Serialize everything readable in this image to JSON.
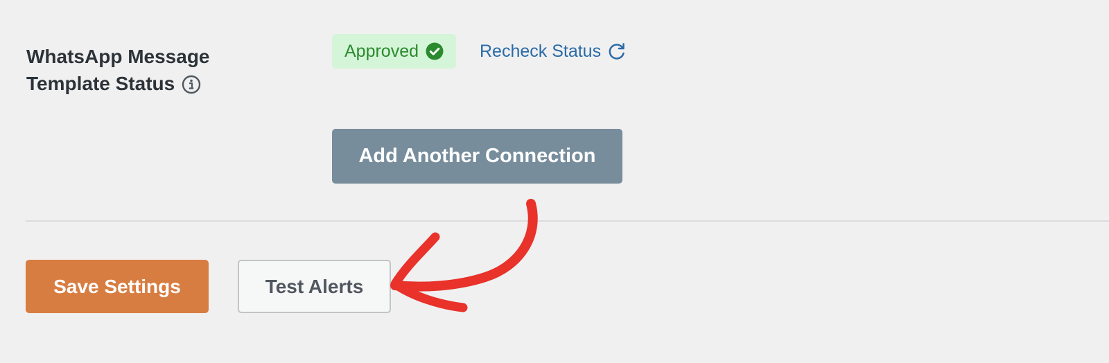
{
  "field": {
    "label_line1": "WhatsApp Message",
    "label_line2": "Template Status",
    "info_icon": "info-circle-icon"
  },
  "status": {
    "badge_text": "Approved",
    "badge_icon": "check-circle-icon",
    "badge_bg": "#d5f5d9",
    "badge_color": "#2c8a2e",
    "recheck_label": "Recheck Status",
    "recheck_icon": "refresh-icon",
    "link_color": "#2b6aa6"
  },
  "connection": {
    "add_button_label": "Add Another Connection",
    "button_color": "#778d9c"
  },
  "actions": {
    "save_label": "Save Settings",
    "save_color": "#d87d41",
    "test_label": "Test Alerts"
  },
  "annotation": {
    "arrow_icon": "hand-drawn-arrow-icon",
    "arrow_color": "#e8322a"
  }
}
